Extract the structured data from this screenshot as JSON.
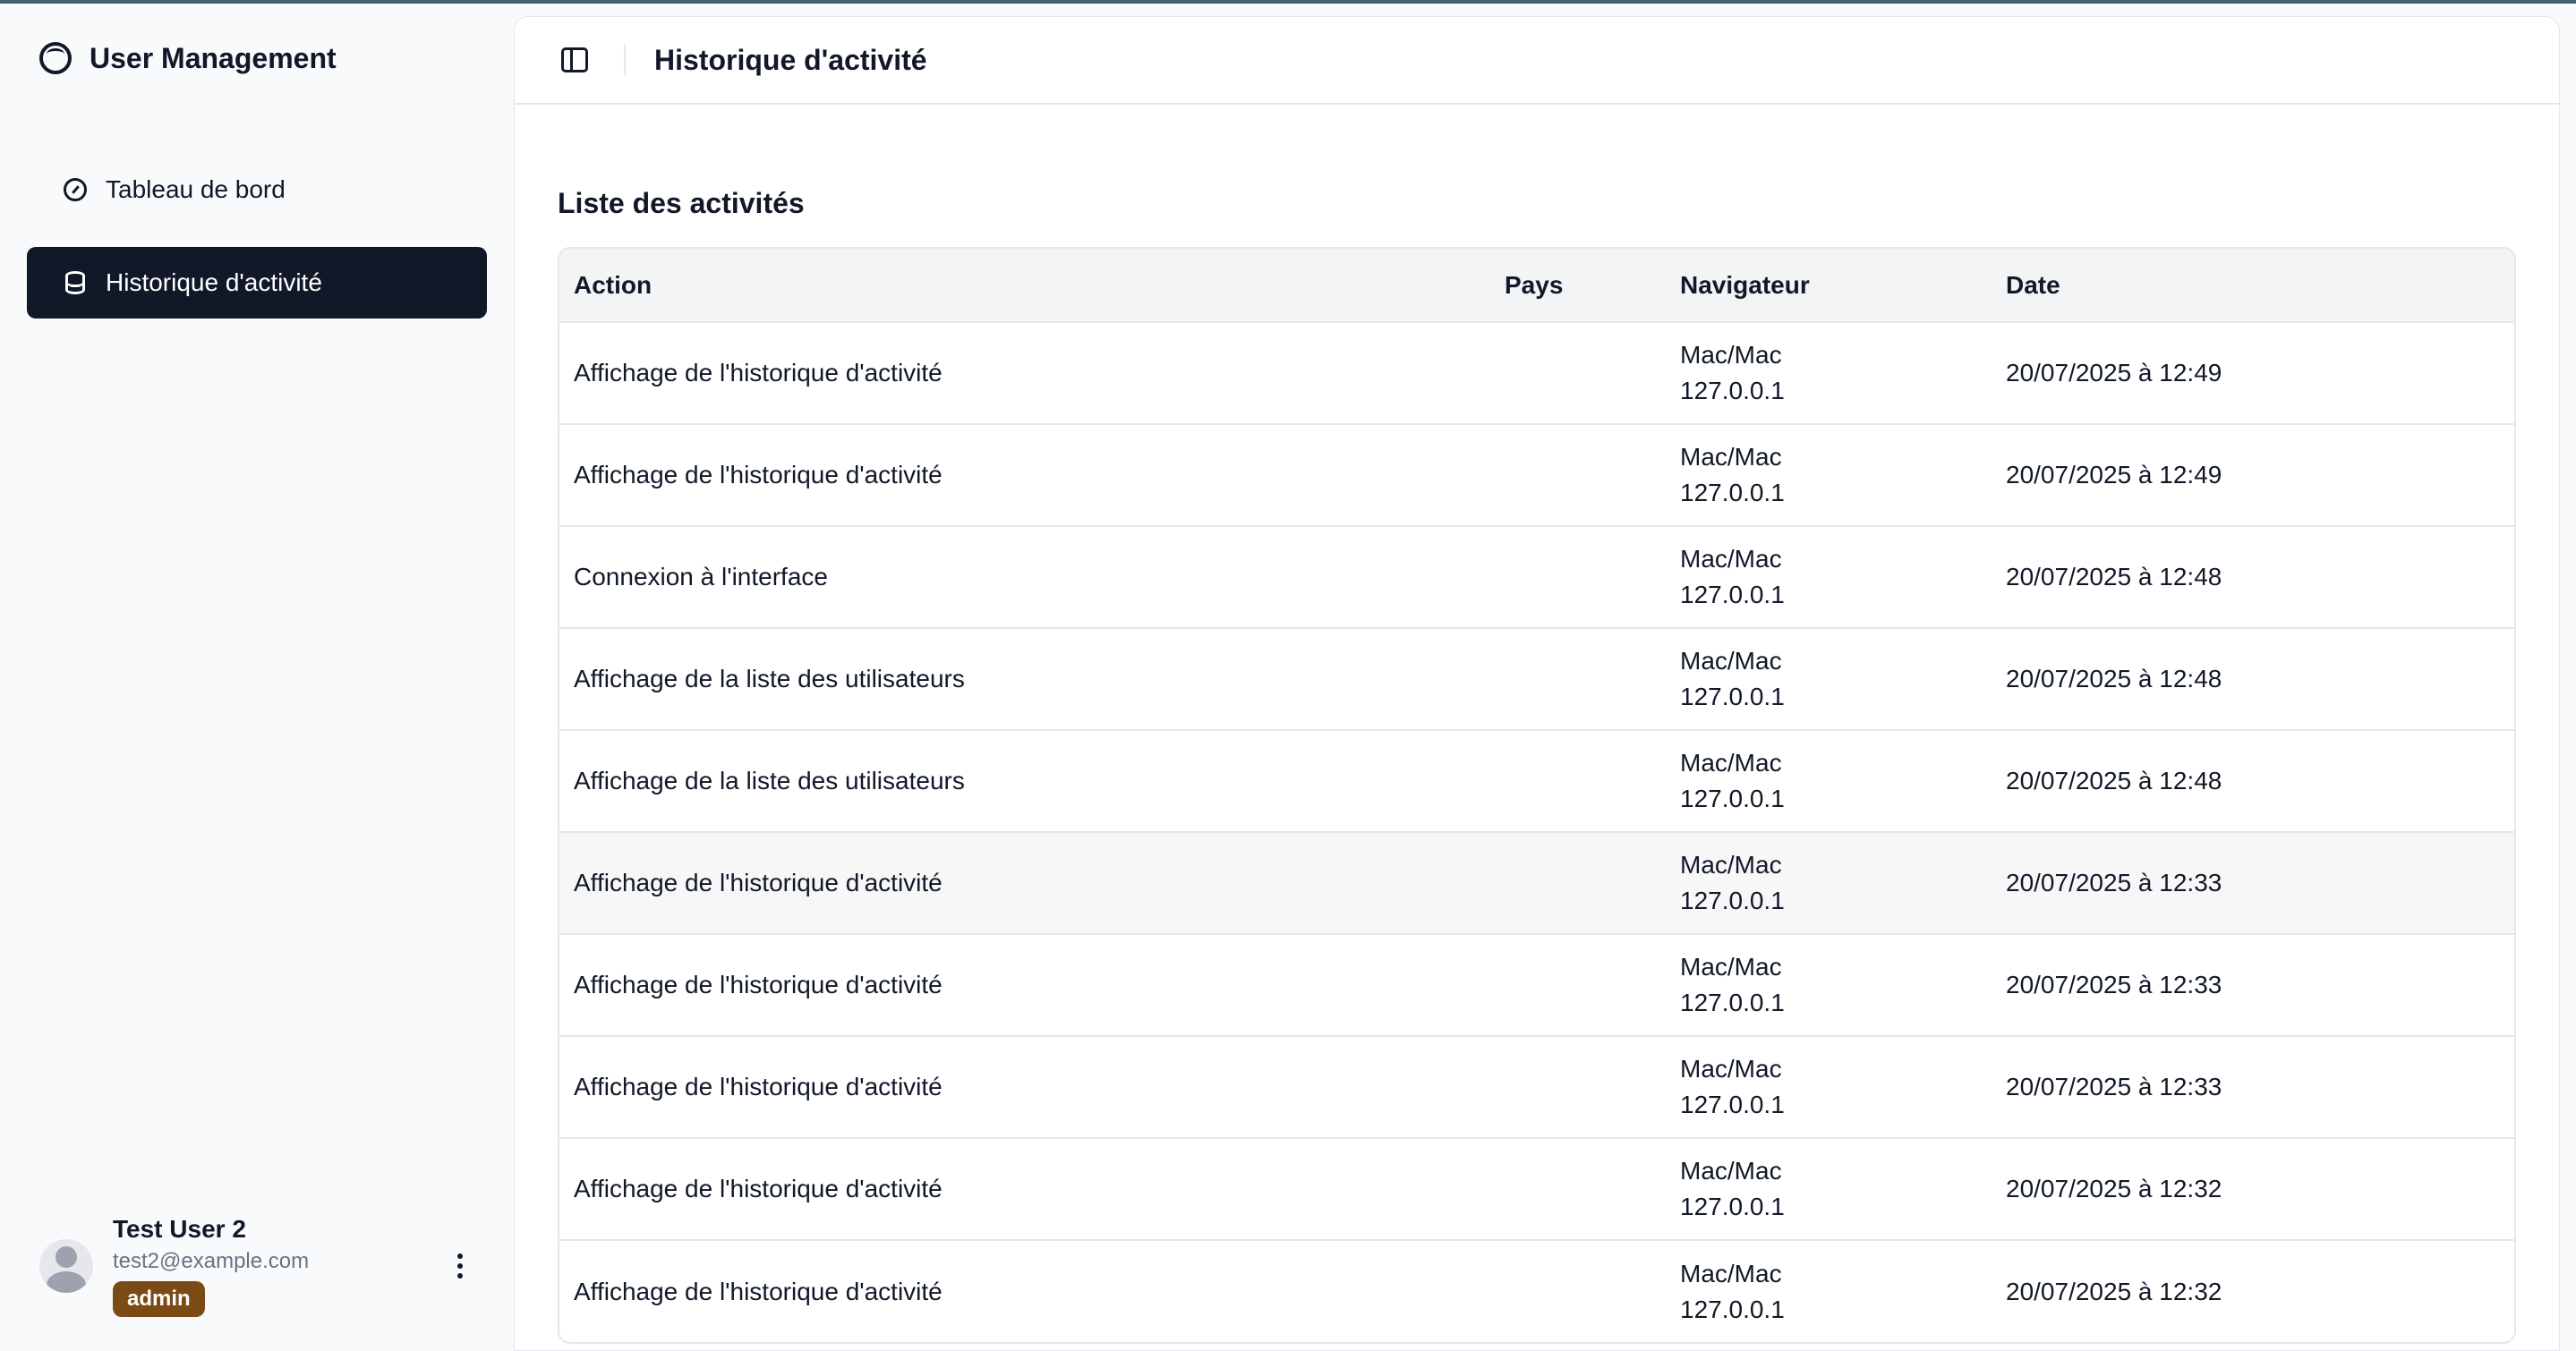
{
  "app": {
    "title": "User Management"
  },
  "sidebar": {
    "items": [
      {
        "label": "Tableau de bord",
        "icon": "gauge-icon",
        "active": false
      },
      {
        "label": "Historique d'activité",
        "icon": "database-icon",
        "active": true
      }
    ]
  },
  "user": {
    "name": "Test User 2",
    "email": "test2@example.com",
    "role": "admin"
  },
  "header": {
    "title": "Historique d'activité"
  },
  "main": {
    "section_title": "Liste des activités",
    "table": {
      "columns": [
        "Action",
        "Pays",
        "Navigateur",
        "Date"
      ],
      "rows": [
        {
          "action": "Affichage de l'historique d'activité",
          "pays": "",
          "nav_browser": "Mac/Mac",
          "nav_ip": "127.0.0.1",
          "date": "20/07/2025 à 12:49"
        },
        {
          "action": "Affichage de l'historique d'activité",
          "pays": "",
          "nav_browser": "Mac/Mac",
          "nav_ip": "127.0.0.1",
          "date": "20/07/2025 à 12:49"
        },
        {
          "action": "Connexion à l'interface",
          "pays": "",
          "nav_browser": "Mac/Mac",
          "nav_ip": "127.0.0.1",
          "date": "20/07/2025 à 12:48"
        },
        {
          "action": "Affichage de la liste des utilisateurs",
          "pays": "",
          "nav_browser": "Mac/Mac",
          "nav_ip": "127.0.0.1",
          "date": "20/07/2025 à 12:48"
        },
        {
          "action": "Affichage de la liste des utilisateurs",
          "pays": "",
          "nav_browser": "Mac/Mac",
          "nav_ip": "127.0.0.1",
          "date": "20/07/2025 à 12:48"
        },
        {
          "action": "Affichage de l'historique d'activité",
          "pays": "",
          "nav_browser": "Mac/Mac",
          "nav_ip": "127.0.0.1",
          "date": "20/07/2025 à 12:33"
        },
        {
          "action": "Affichage de l'historique d'activité",
          "pays": "",
          "nav_browser": "Mac/Mac",
          "nav_ip": "127.0.0.1",
          "date": "20/07/2025 à 12:33"
        },
        {
          "action": "Affichage de l'historique d'activité",
          "pays": "",
          "nav_browser": "Mac/Mac",
          "nav_ip": "127.0.0.1",
          "date": "20/07/2025 à 12:33"
        },
        {
          "action": "Affichage de l'historique d'activité",
          "pays": "",
          "nav_browser": "Mac/Mac",
          "nav_ip": "127.0.0.1",
          "date": "20/07/2025 à 12:32"
        },
        {
          "action": "Affichage de l'historique d'activité",
          "pays": "",
          "nav_browser": "Mac/Mac",
          "nav_ip": "127.0.0.1",
          "date": "20/07/2025 à 12:32"
        }
      ]
    }
  },
  "colors": {
    "active_nav_bg": "#111827",
    "role_badge_bg": "#7c4a14",
    "table_header_bg": "#f3f4f6"
  }
}
